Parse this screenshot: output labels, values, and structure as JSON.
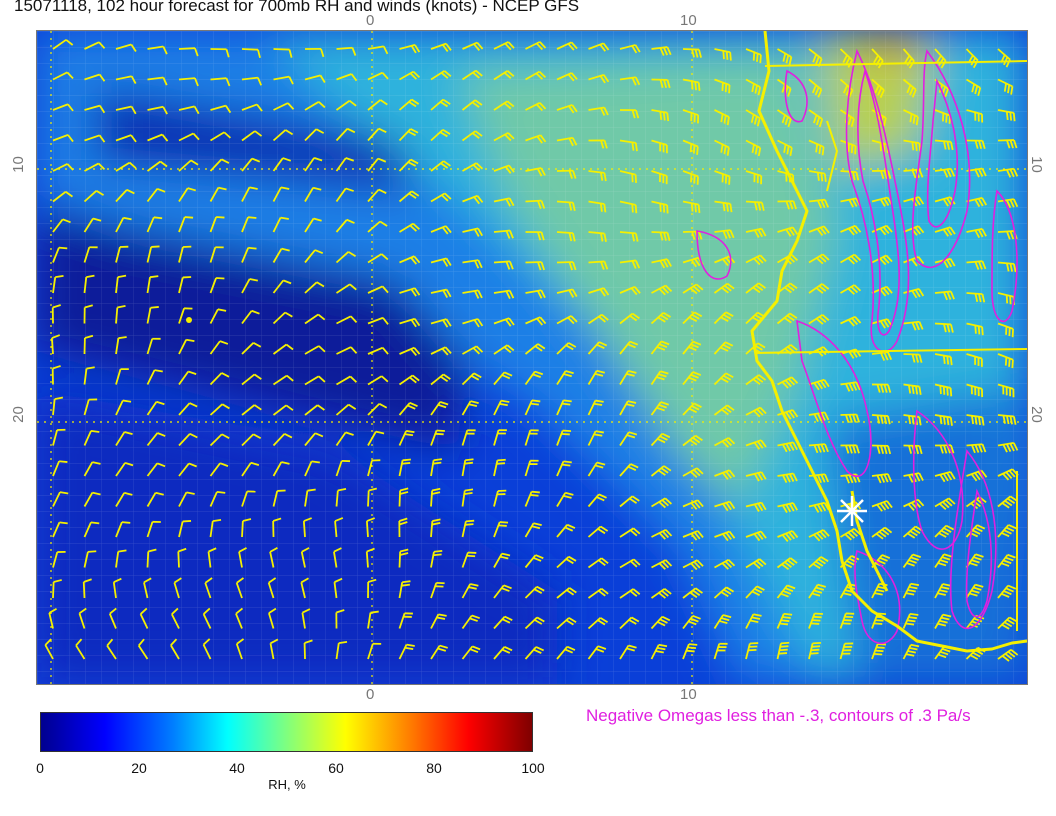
{
  "title": "15071118, 102 hour forecast for 700mb RH and winds (knots) - NCEP GFS",
  "ticks": {
    "top": [
      "0",
      "10"
    ],
    "bottom": [
      "0",
      "10"
    ],
    "left": [
      "10",
      "20"
    ],
    "right": [
      "10",
      "20"
    ]
  },
  "colorbar": {
    "labels": [
      "0",
      "20",
      "40",
      "60",
      "80",
      "100"
    ],
    "unit": "RH, %"
  },
  "note": "Negative Omegas less than -.3, contours of .3 Pa/s",
  "colors": {
    "barbs": "#f5f000",
    "coast": "#f5f000",
    "omega": "#e020e0",
    "marker": "#ffffff"
  },
  "icons": {
    "location_marker": "star-marker-icon"
  }
}
